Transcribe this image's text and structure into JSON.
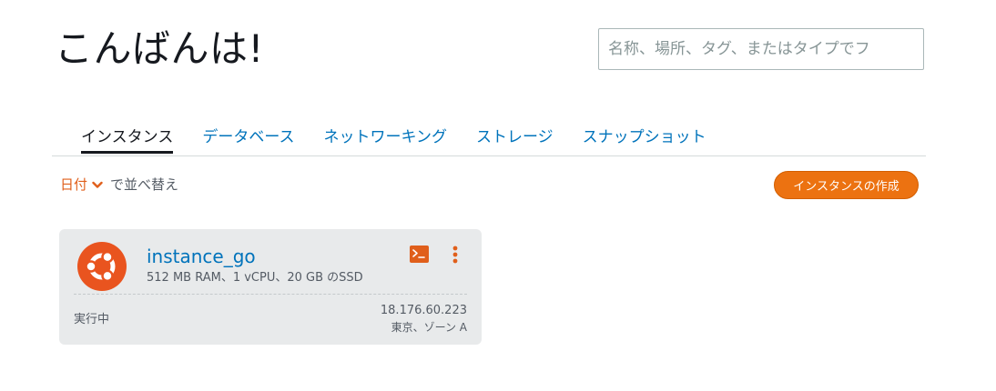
{
  "header": {
    "greeting": "こんばんは!",
    "search_placeholder": "名称、場所、タグ、またはタイプでフ"
  },
  "tabs": [
    {
      "label": "インスタンス",
      "active": true
    },
    {
      "label": "データベース",
      "active": false
    },
    {
      "label": "ネットワーキング",
      "active": false
    },
    {
      "label": "ストレージ",
      "active": false
    },
    {
      "label": "スナップショット",
      "active": false
    }
  ],
  "sort": {
    "selected": "日付",
    "suffix": "で並べ替え"
  },
  "create_button_label": "インスタンスの作成",
  "instance": {
    "name": "instance_go",
    "specs": "512 MB RAM、1 vCPU、20 GB のSSD",
    "status": "実行中",
    "ip": "18.176.60.223",
    "zone": "東京、ゾーン A",
    "os_icon": "ubuntu-logo"
  },
  "colors": {
    "accent_orange": "#ec7211",
    "link_blue": "#0073bb",
    "card_bg": "#e8eaeb",
    "ubuntu_orange": "#e9541f"
  }
}
